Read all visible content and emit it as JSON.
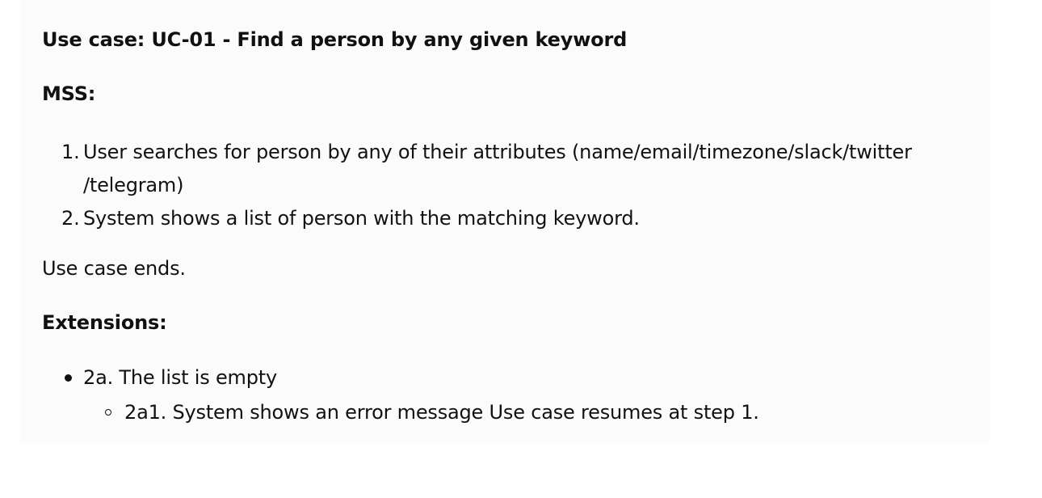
{
  "title": "Use case: UC-01 - Find a person by any given keyword",
  "mss_heading": "MSS:",
  "mss_steps": [
    {
      "number": "1.",
      "text": "User searches for person by any of their attributes (name/email/timezone/slack/twitter /telegram)"
    },
    {
      "number": "2.",
      "text": "System shows a list of person with the matching keyword."
    }
  ],
  "ends_text": "Use case ends.",
  "extensions_heading": "Extensions:",
  "extensions": [
    {
      "text": "2a. The list is empty",
      "sub": [
        {
          "text": "2a1. System shows an error message Use case resumes at step 1."
        }
      ]
    }
  ]
}
